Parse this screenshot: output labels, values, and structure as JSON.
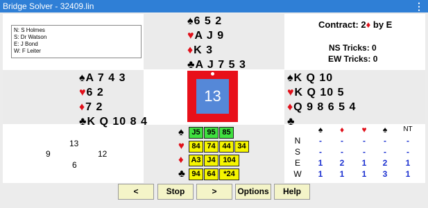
{
  "app": {
    "title": "Bridge Solver - 32409.lin",
    "menu_icon": "⋮"
  },
  "players": [
    "N: S Holmes",
    "S: Dr Watson",
    "E: J Bond",
    "W: F Leiter"
  ],
  "contract": {
    "prefix": "Contract: 2",
    "suit": "♦",
    "suffix": " by E"
  },
  "tricks": {
    "ns": "NS Tricks: 0",
    "ew": "EW Tricks: 0"
  },
  "north": [
    {
      "suit": "♠",
      "cards": "6 5 2"
    },
    {
      "suit": "♥",
      "cards": "A J 9"
    },
    {
      "suit": "♦",
      "cards": "K 3"
    },
    {
      "suit": "♣",
      "cards": "A J 7 5 3"
    }
  ],
  "west": [
    {
      "suit": "♠",
      "cards": "A 7 4 3"
    },
    {
      "suit": "♥",
      "cards": "6 2"
    },
    {
      "suit": "♦",
      "cards": "7 2"
    },
    {
      "suit": "♣",
      "cards": "K Q 10 8 4"
    }
  ],
  "east": [
    {
      "suit": "♠",
      "cards": "K Q 10"
    },
    {
      "suit": "♥",
      "cards": "K Q 10 5"
    },
    {
      "suit": "♦",
      "cards": "Q 9 8 6 5 4"
    },
    {
      "suit": "♣",
      "cards": ""
    }
  ],
  "board_number": "13",
  "vul_numbers": {
    "top": "13",
    "left": "9",
    "right": "12",
    "bottom": "6"
  },
  "south_chips": {
    "spades": [
      "J5",
      "95",
      "85"
    ],
    "hearts": [
      "84",
      "74",
      "44",
      "34"
    ],
    "diamonds": [
      "A3",
      "J4",
      "104"
    ],
    "clubs": [
      "94",
      "64",
      "*24"
    ]
  },
  "dd_table": {
    "headers": [
      "♠",
      "♦",
      "♥",
      "♠",
      "NT"
    ],
    "rows": [
      {
        "label": "N",
        "vals": [
          "-",
          "-",
          "-",
          "-",
          "-"
        ]
      },
      {
        "label": "S",
        "vals": [
          "-",
          "-",
          "-",
          "-",
          "-"
        ]
      },
      {
        "label": "E",
        "vals": [
          "1",
          "2",
          "1",
          "2",
          "1"
        ]
      },
      {
        "label": "W",
        "vals": [
          "1",
          "1",
          "1",
          "3",
          "1"
        ]
      }
    ]
  },
  "buttons": [
    "<",
    "Stop",
    ">",
    "Options",
    "Help"
  ]
}
